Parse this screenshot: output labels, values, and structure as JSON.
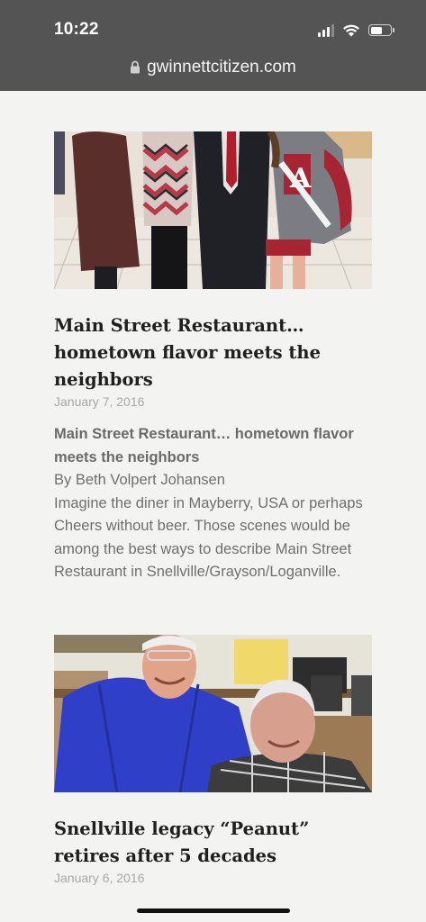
{
  "status_bar": {
    "time": "10:22"
  },
  "browser": {
    "url": "gwinnettcitizen.com"
  },
  "articles": [
    {
      "image_alt": "Four people posing together in a restaurant",
      "headline": "Main Street Restaurant… hometown flavor meets the neighbors",
      "date": "January 7, 2016",
      "excerpt_title": "Main Street Restaurant… hometown flavor meets the neighbors",
      "byline": "By Beth Volpert Johansen",
      "excerpt": "Imagine the diner in Mayberry, USA or perhaps Cheers without beer. Those scenes would be among the best ways to describe Main Street Restaurant in Snellville/Grayson/Loganville."
    },
    {
      "image_alt": "Two older men smiling in a restaurant kitchen",
      "headline": "Snellville legacy “Peanut” retires after 5 decades",
      "date": "January 6, 2016"
    }
  ],
  "colors": {
    "chrome": "#545454",
    "page_bg": "#f3f3f1",
    "headline": "#1f1f1f",
    "date": "#a8a8a8",
    "body_text": "#6f6f6f"
  }
}
